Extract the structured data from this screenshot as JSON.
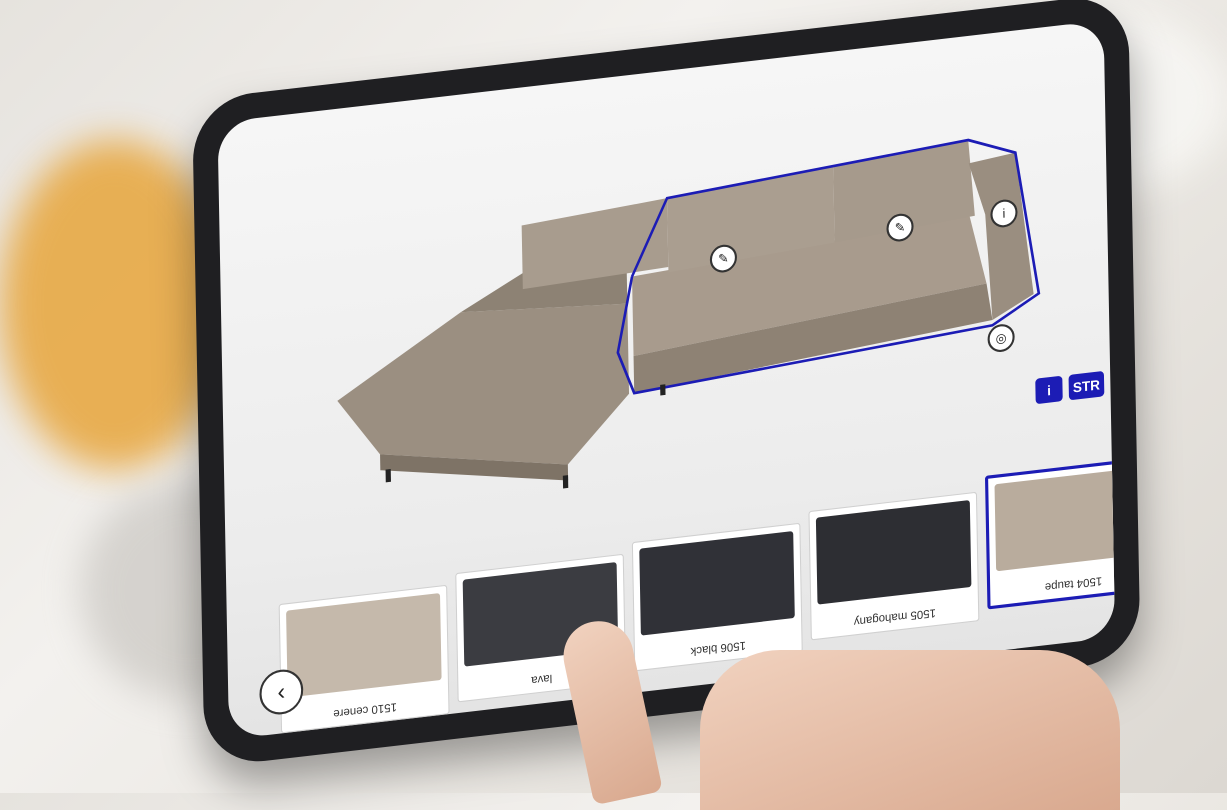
{
  "toolbar": {
    "str_label": "STR",
    "info_label": "i"
  },
  "bottom_controls": {
    "search_icon": "search-icon",
    "close_icon": "close-icon",
    "next_icon": "chevron-icon"
  },
  "swatches": [
    {
      "label": "1504 taupe",
      "color": "#b9ac9d",
      "selected": true
    },
    {
      "label": "1505 mahogany",
      "color": "#2d2e33",
      "selected": false
    },
    {
      "label": "1506 black",
      "color": "#303137",
      "selected": false
    },
    {
      "label": "lava",
      "color": "#3b3c41",
      "selected": false
    },
    {
      "label": "1510 cenere",
      "color": "#c5b9ab",
      "selected": false
    }
  ],
  "colors": {
    "accent": "#1c1cb5",
    "sofa": "#a09486",
    "bezel": "#1f1f22"
  }
}
